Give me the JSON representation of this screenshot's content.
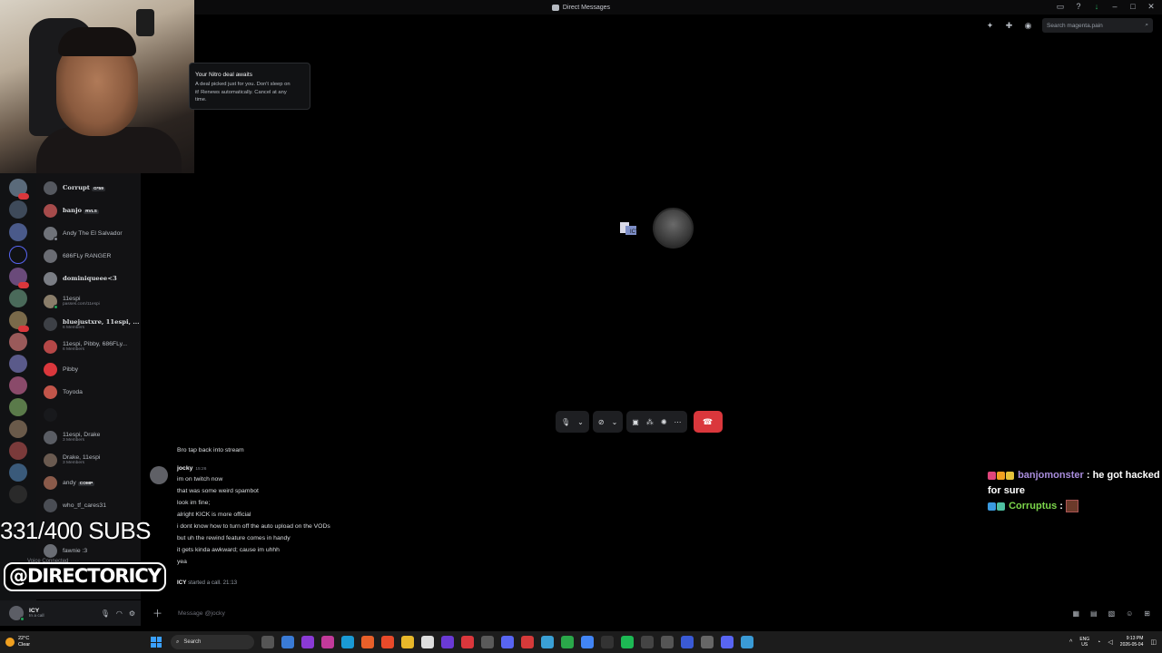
{
  "window": {
    "title": "Direct Messages"
  },
  "toolbar": {
    "search_placeholder": "Search magenta.pain"
  },
  "nitro_popup": {
    "title": "Your Nitro deal awaits",
    "body_line1": "A deal picked just for you. Don't sleep on",
    "body_line2": "it! Renews automatically. Cancel at any",
    "body_line3": "time."
  },
  "dm_list": [
    {
      "name": "Corrupt",
      "tag": "G*59",
      "sub": ""
    },
    {
      "name": "banjo",
      "tag": "RVLS",
      "sub": ""
    },
    {
      "name": "Andy The El Salvador",
      "tag": "",
      "sub": ""
    },
    {
      "name": "686FLy RANGER",
      "tag": "",
      "sub": ""
    },
    {
      "name": "dominiqueee<3",
      "tag": "",
      "sub": ""
    },
    {
      "name": "11espi",
      "tag": "",
      "sub": "passes.com/11espi"
    },
    {
      "name": "bluejustxre, 11espi, ...",
      "tag": "",
      "sub": "6 Members"
    },
    {
      "name": "11espi, Pibby, 686FLy...",
      "tag": "",
      "sub": "6 Members"
    },
    {
      "name": "Pibby",
      "tag": "",
      "sub": ""
    },
    {
      "name": "Toyoda",
      "tag": "",
      "sub": ""
    },
    {
      "name": "",
      "tag": "",
      "sub": ""
    },
    {
      "name": "11espi, Drake",
      "tag": "",
      "sub": "3 Members"
    },
    {
      "name": "Drake, 11espi",
      "tag": "",
      "sub": "3 Members"
    },
    {
      "name": "andy",
      "tag": "COMP",
      "sub": ""
    },
    {
      "name": "who_tf_cares31",
      "tag": "",
      "sub": ""
    },
    {
      "name": "fawnie :3",
      "tag": "",
      "sub": ""
    }
  ],
  "voice_status": "Voice Connected",
  "user_panel": {
    "name": "ICY",
    "status": "In a call"
  },
  "overlay": {
    "subs": "331/400 SUBS",
    "handle": "@DIRECTORICY"
  },
  "chat": {
    "first_line": "Bro tap back into stream",
    "author": "jocky",
    "time": "15:26",
    "messages": [
      "im on twitch now",
      "that was some weird spambot",
      "look im fine;",
      "alright KICK is more official",
      "i dont know how to turn off the auto upload on the VODs",
      "but uh the rewind feature comes in handy",
      "it gets kinda awkward; cause im uhhh",
      "yea"
    ],
    "system_user": "ICY",
    "system_text": "started a call.",
    "system_time": "21:13"
  },
  "input": {
    "placeholder": "Message @jocky"
  },
  "stream_chat": [
    {
      "user": "banjomonster",
      "text": "he got hacked for sure"
    },
    {
      "user": "Corruptus",
      "text": ""
    }
  ],
  "taskbar": {
    "temp": "22°C",
    "weather": "Clear",
    "search": "Search",
    "lang1": "ENG",
    "lang2": "US",
    "time": "9:13 PM",
    "date": "2026-05-04"
  },
  "colors": {
    "accent_red": "#da373c",
    "online_green": "#23a55a",
    "stream_user1": "#a98ddd",
    "stream_user2": "#7cd64b"
  }
}
